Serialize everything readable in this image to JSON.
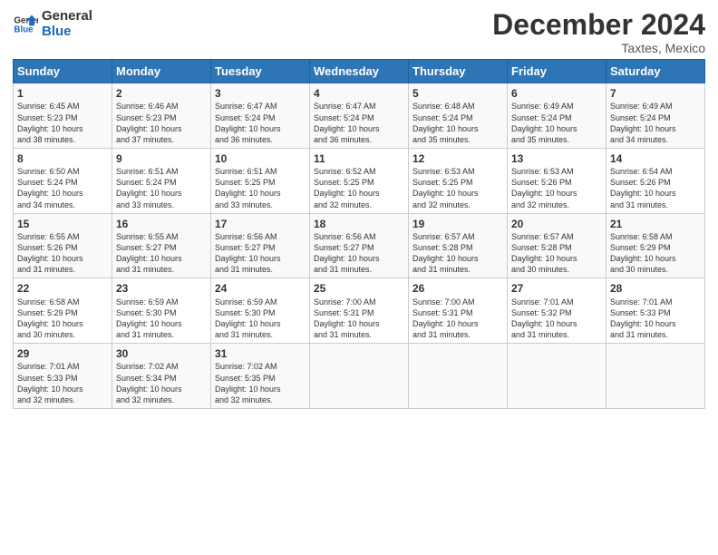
{
  "logo": {
    "line1": "General",
    "line2": "Blue"
  },
  "title": "December 2024",
  "location": "Taxtes, Mexico",
  "days_of_week": [
    "Sunday",
    "Monday",
    "Tuesday",
    "Wednesday",
    "Thursday",
    "Friday",
    "Saturday"
  ],
  "weeks": [
    [
      {
        "day": "1",
        "info": "Sunrise: 6:45 AM\nSunset: 5:23 PM\nDaylight: 10 hours\nand 38 minutes."
      },
      {
        "day": "2",
        "info": "Sunrise: 6:46 AM\nSunset: 5:23 PM\nDaylight: 10 hours\nand 37 minutes."
      },
      {
        "day": "3",
        "info": "Sunrise: 6:47 AM\nSunset: 5:24 PM\nDaylight: 10 hours\nand 36 minutes."
      },
      {
        "day": "4",
        "info": "Sunrise: 6:47 AM\nSunset: 5:24 PM\nDaylight: 10 hours\nand 36 minutes."
      },
      {
        "day": "5",
        "info": "Sunrise: 6:48 AM\nSunset: 5:24 PM\nDaylight: 10 hours\nand 35 minutes."
      },
      {
        "day": "6",
        "info": "Sunrise: 6:49 AM\nSunset: 5:24 PM\nDaylight: 10 hours\nand 35 minutes."
      },
      {
        "day": "7",
        "info": "Sunrise: 6:49 AM\nSunset: 5:24 PM\nDaylight: 10 hours\nand 34 minutes."
      }
    ],
    [
      {
        "day": "8",
        "info": "Sunrise: 6:50 AM\nSunset: 5:24 PM\nDaylight: 10 hours\nand 34 minutes."
      },
      {
        "day": "9",
        "info": "Sunrise: 6:51 AM\nSunset: 5:24 PM\nDaylight: 10 hours\nand 33 minutes."
      },
      {
        "day": "10",
        "info": "Sunrise: 6:51 AM\nSunset: 5:25 PM\nDaylight: 10 hours\nand 33 minutes."
      },
      {
        "day": "11",
        "info": "Sunrise: 6:52 AM\nSunset: 5:25 PM\nDaylight: 10 hours\nand 32 minutes."
      },
      {
        "day": "12",
        "info": "Sunrise: 6:53 AM\nSunset: 5:25 PM\nDaylight: 10 hours\nand 32 minutes."
      },
      {
        "day": "13",
        "info": "Sunrise: 6:53 AM\nSunset: 5:26 PM\nDaylight: 10 hours\nand 32 minutes."
      },
      {
        "day": "14",
        "info": "Sunrise: 6:54 AM\nSunset: 5:26 PM\nDaylight: 10 hours\nand 31 minutes."
      }
    ],
    [
      {
        "day": "15",
        "info": "Sunrise: 6:55 AM\nSunset: 5:26 PM\nDaylight: 10 hours\nand 31 minutes."
      },
      {
        "day": "16",
        "info": "Sunrise: 6:55 AM\nSunset: 5:27 PM\nDaylight: 10 hours\nand 31 minutes."
      },
      {
        "day": "17",
        "info": "Sunrise: 6:56 AM\nSunset: 5:27 PM\nDaylight: 10 hours\nand 31 minutes."
      },
      {
        "day": "18",
        "info": "Sunrise: 6:56 AM\nSunset: 5:27 PM\nDaylight: 10 hours\nand 31 minutes."
      },
      {
        "day": "19",
        "info": "Sunrise: 6:57 AM\nSunset: 5:28 PM\nDaylight: 10 hours\nand 31 minutes."
      },
      {
        "day": "20",
        "info": "Sunrise: 6:57 AM\nSunset: 5:28 PM\nDaylight: 10 hours\nand 30 minutes."
      },
      {
        "day": "21",
        "info": "Sunrise: 6:58 AM\nSunset: 5:29 PM\nDaylight: 10 hours\nand 30 minutes."
      }
    ],
    [
      {
        "day": "22",
        "info": "Sunrise: 6:58 AM\nSunset: 5:29 PM\nDaylight: 10 hours\nand 30 minutes."
      },
      {
        "day": "23",
        "info": "Sunrise: 6:59 AM\nSunset: 5:30 PM\nDaylight: 10 hours\nand 31 minutes."
      },
      {
        "day": "24",
        "info": "Sunrise: 6:59 AM\nSunset: 5:30 PM\nDaylight: 10 hours\nand 31 minutes."
      },
      {
        "day": "25",
        "info": "Sunrise: 7:00 AM\nSunset: 5:31 PM\nDaylight: 10 hours\nand 31 minutes."
      },
      {
        "day": "26",
        "info": "Sunrise: 7:00 AM\nSunset: 5:31 PM\nDaylight: 10 hours\nand 31 minutes."
      },
      {
        "day": "27",
        "info": "Sunrise: 7:01 AM\nSunset: 5:32 PM\nDaylight: 10 hours\nand 31 minutes."
      },
      {
        "day": "28",
        "info": "Sunrise: 7:01 AM\nSunset: 5:33 PM\nDaylight: 10 hours\nand 31 minutes."
      }
    ],
    [
      {
        "day": "29",
        "info": "Sunrise: 7:01 AM\nSunset: 5:33 PM\nDaylight: 10 hours\nand 32 minutes."
      },
      {
        "day": "30",
        "info": "Sunrise: 7:02 AM\nSunset: 5:34 PM\nDaylight: 10 hours\nand 32 minutes."
      },
      {
        "day": "31",
        "info": "Sunrise: 7:02 AM\nSunset: 5:35 PM\nDaylight: 10 hours\nand 32 minutes."
      },
      {
        "day": "",
        "info": ""
      },
      {
        "day": "",
        "info": ""
      },
      {
        "day": "",
        "info": ""
      },
      {
        "day": "",
        "info": ""
      }
    ]
  ]
}
